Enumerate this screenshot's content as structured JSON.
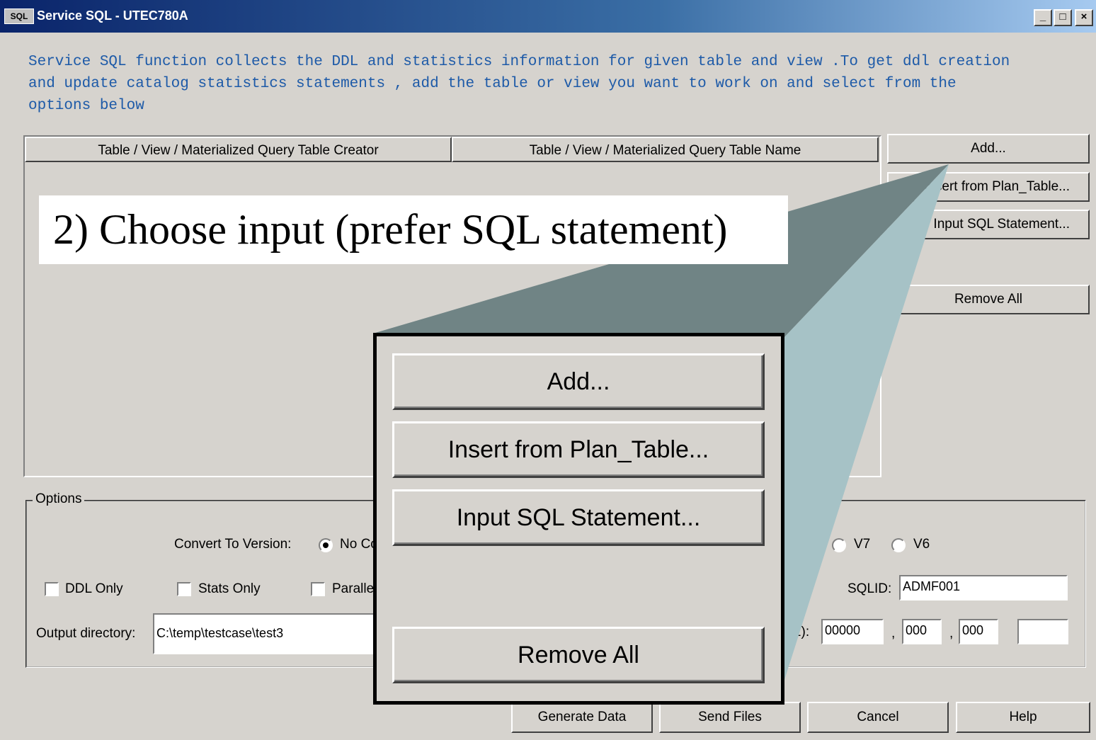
{
  "window": {
    "app_icon": "SQL",
    "title": "Service SQL - UTEC780A",
    "minimize": "_",
    "maximize": "□",
    "close": "×"
  },
  "description": "Service SQL function collects the DDL and statistics information for given table and view .To get ddl creation\nand update catalog statistics statements , add the table or view you want to work on and select from the\noptions below",
  "table": {
    "columns": [
      "Table / View / Materialized Query Table Creator",
      "Table / View / Materialized Query Table Name"
    ],
    "rows": []
  },
  "side_buttons": {
    "add": "Add...",
    "insert_plan_table": "Insert from Plan_Table...",
    "input_sql": "Input SQL Statement...",
    "remove_all": "Remove All"
  },
  "options": {
    "legend": "Options",
    "convert_label": "Convert To Version:",
    "convert_selected": "No Conversion",
    "version_v7": "V7",
    "version_v6": "V6",
    "ddl_only": "DDL Only",
    "stats_only": "Stats Only",
    "parallel": "Parallel",
    "sqlid_label": "SQLID:",
    "sqlid_value": "ADMF001",
    "output_dir_label": "Output directory:",
    "output_dir_value": "C:\\temp\\testcase\\test3",
    "zparm_label_tail": "z):",
    "zparm_1": "00000",
    "zparm_sep_1": ",",
    "zparm_2": "000",
    "zparm_sep_2": ",",
    "zparm_3": "000",
    "zparm_4": ""
  },
  "bottom_buttons": {
    "generate": "Generate Data",
    "send": "Send Files",
    "cancel": "Cancel",
    "help": "Help"
  },
  "callout": {
    "label": "2) Choose input (prefer SQL statement)",
    "zoom_add": "Add...",
    "zoom_insert": "Insert from Plan_Table...",
    "zoom_input_sql": "Input SQL Statement...",
    "zoom_remove_all": "Remove All"
  },
  "colors": {
    "titlebar": "#0a246a",
    "window_bg": "#d6d3ce",
    "description_text": "#1d5aa8",
    "callout_dark": "#708485",
    "callout_light": "#a6c2c6"
  }
}
